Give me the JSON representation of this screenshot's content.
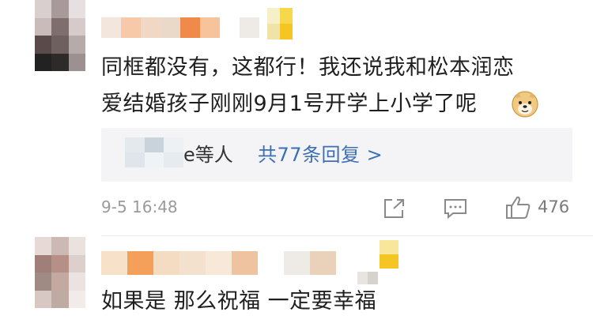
{
  "comments": [
    {
      "text_line1": "同框都没有，这都行！我还说我和松本润恋",
      "text_line2": "爱结婚孩子刚刚9月1号开学上小学了呢",
      "emoji": "doge-emoji",
      "reply_preview": {
        "suffix": "e等人",
        "count_label": "共77条回复 >"
      },
      "time": "9-5 16:48",
      "actions": {
        "share_icon": "share-icon",
        "comment_icon": "comment-icon",
        "like_icon": "like-icon",
        "like_count": "476"
      }
    },
    {
      "text": "如果是 那么祝福 一定要幸福"
    }
  ]
}
